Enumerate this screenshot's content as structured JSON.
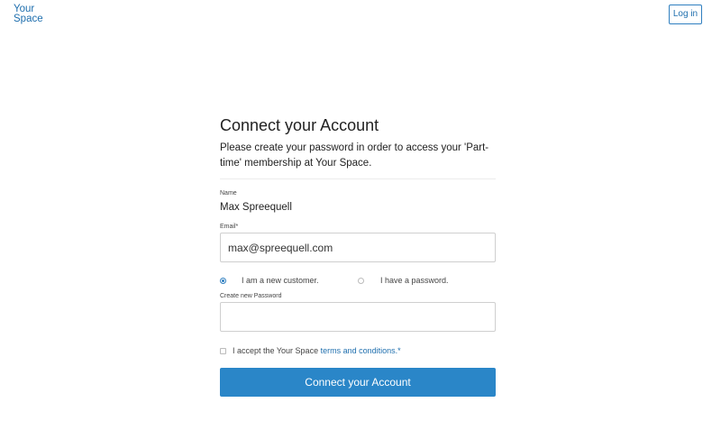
{
  "header": {
    "logo_line1": "Your",
    "logo_line2": "Space",
    "login_label": "Log in"
  },
  "form": {
    "title": "Connect your Account",
    "subtitle": "Please create your password in order to access your 'Part-time' membership at Your Space.",
    "name_label": "Name",
    "name_value": "Max Spreequell",
    "email_label": "Email*",
    "email_value": "max@spreequell.com",
    "radio_new_label": "I am a new customer.",
    "radio_existing_label": "I have a password.",
    "password_label": "Create new Password",
    "password_value": "",
    "terms_prefix": "I accept the Your Space ",
    "terms_link": "terms and conditions.*",
    "submit_label": "Connect your Account"
  },
  "colors": {
    "accent": "#2a86c8",
    "link": "#1f6fae"
  }
}
